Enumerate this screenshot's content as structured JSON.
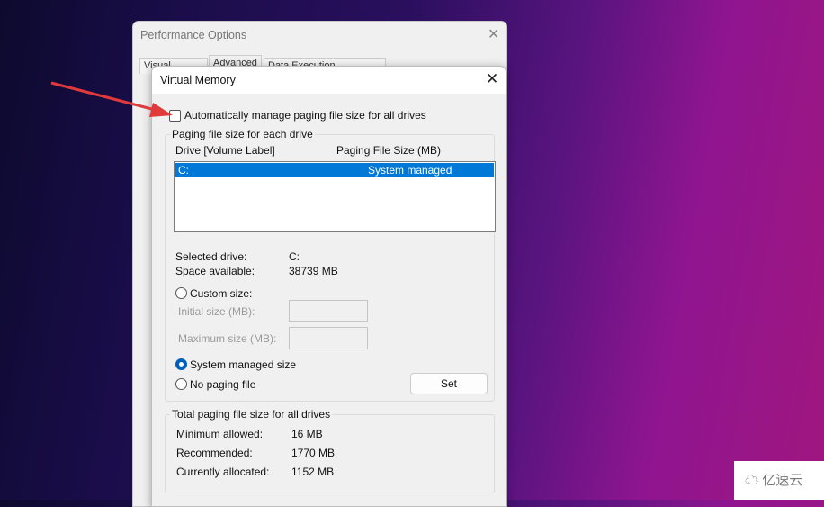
{
  "performance_options": {
    "title": "Performance Options",
    "tabs": [
      "Visual Effects",
      "Advanced",
      "Data Execution Prevention"
    ]
  },
  "virtual_memory": {
    "title": "Virtual Memory",
    "auto_manage_label": "Automatically manage paging file size for all drives",
    "auto_manage_checked": false,
    "paging_group": {
      "legend": "Paging file size for each drive",
      "col_drive": "Drive  [Volume Label]",
      "col_size": "Paging File Size (MB)",
      "rows": [
        {
          "drive": "C:",
          "size": "System managed",
          "selected": true
        }
      ]
    },
    "selected_drive_label": "Selected drive:",
    "selected_drive_value": "C:",
    "space_label": "Space available:",
    "space_value": "38739 MB",
    "custom_size_label": "Custom size:",
    "initial_label": "Initial size (MB):",
    "initial_value": "",
    "maximum_label": "Maximum size (MB):",
    "maximum_value": "",
    "system_managed_label": "System managed size",
    "no_paging_label": "No paging file",
    "selected_option": "System managed size",
    "set_button": "Set",
    "totals": {
      "legend": "Total paging file size for all drives",
      "min_label": "Minimum allowed:",
      "min_value": "16 MB",
      "rec_label": "Recommended:",
      "rec_value": "1770 MB",
      "cur_label": "Currently allocated:",
      "cur_value": "1152 MB"
    }
  },
  "annotation": {
    "arrow_color": "#e03a3a"
  },
  "watermark": {
    "text": "亿速云"
  }
}
